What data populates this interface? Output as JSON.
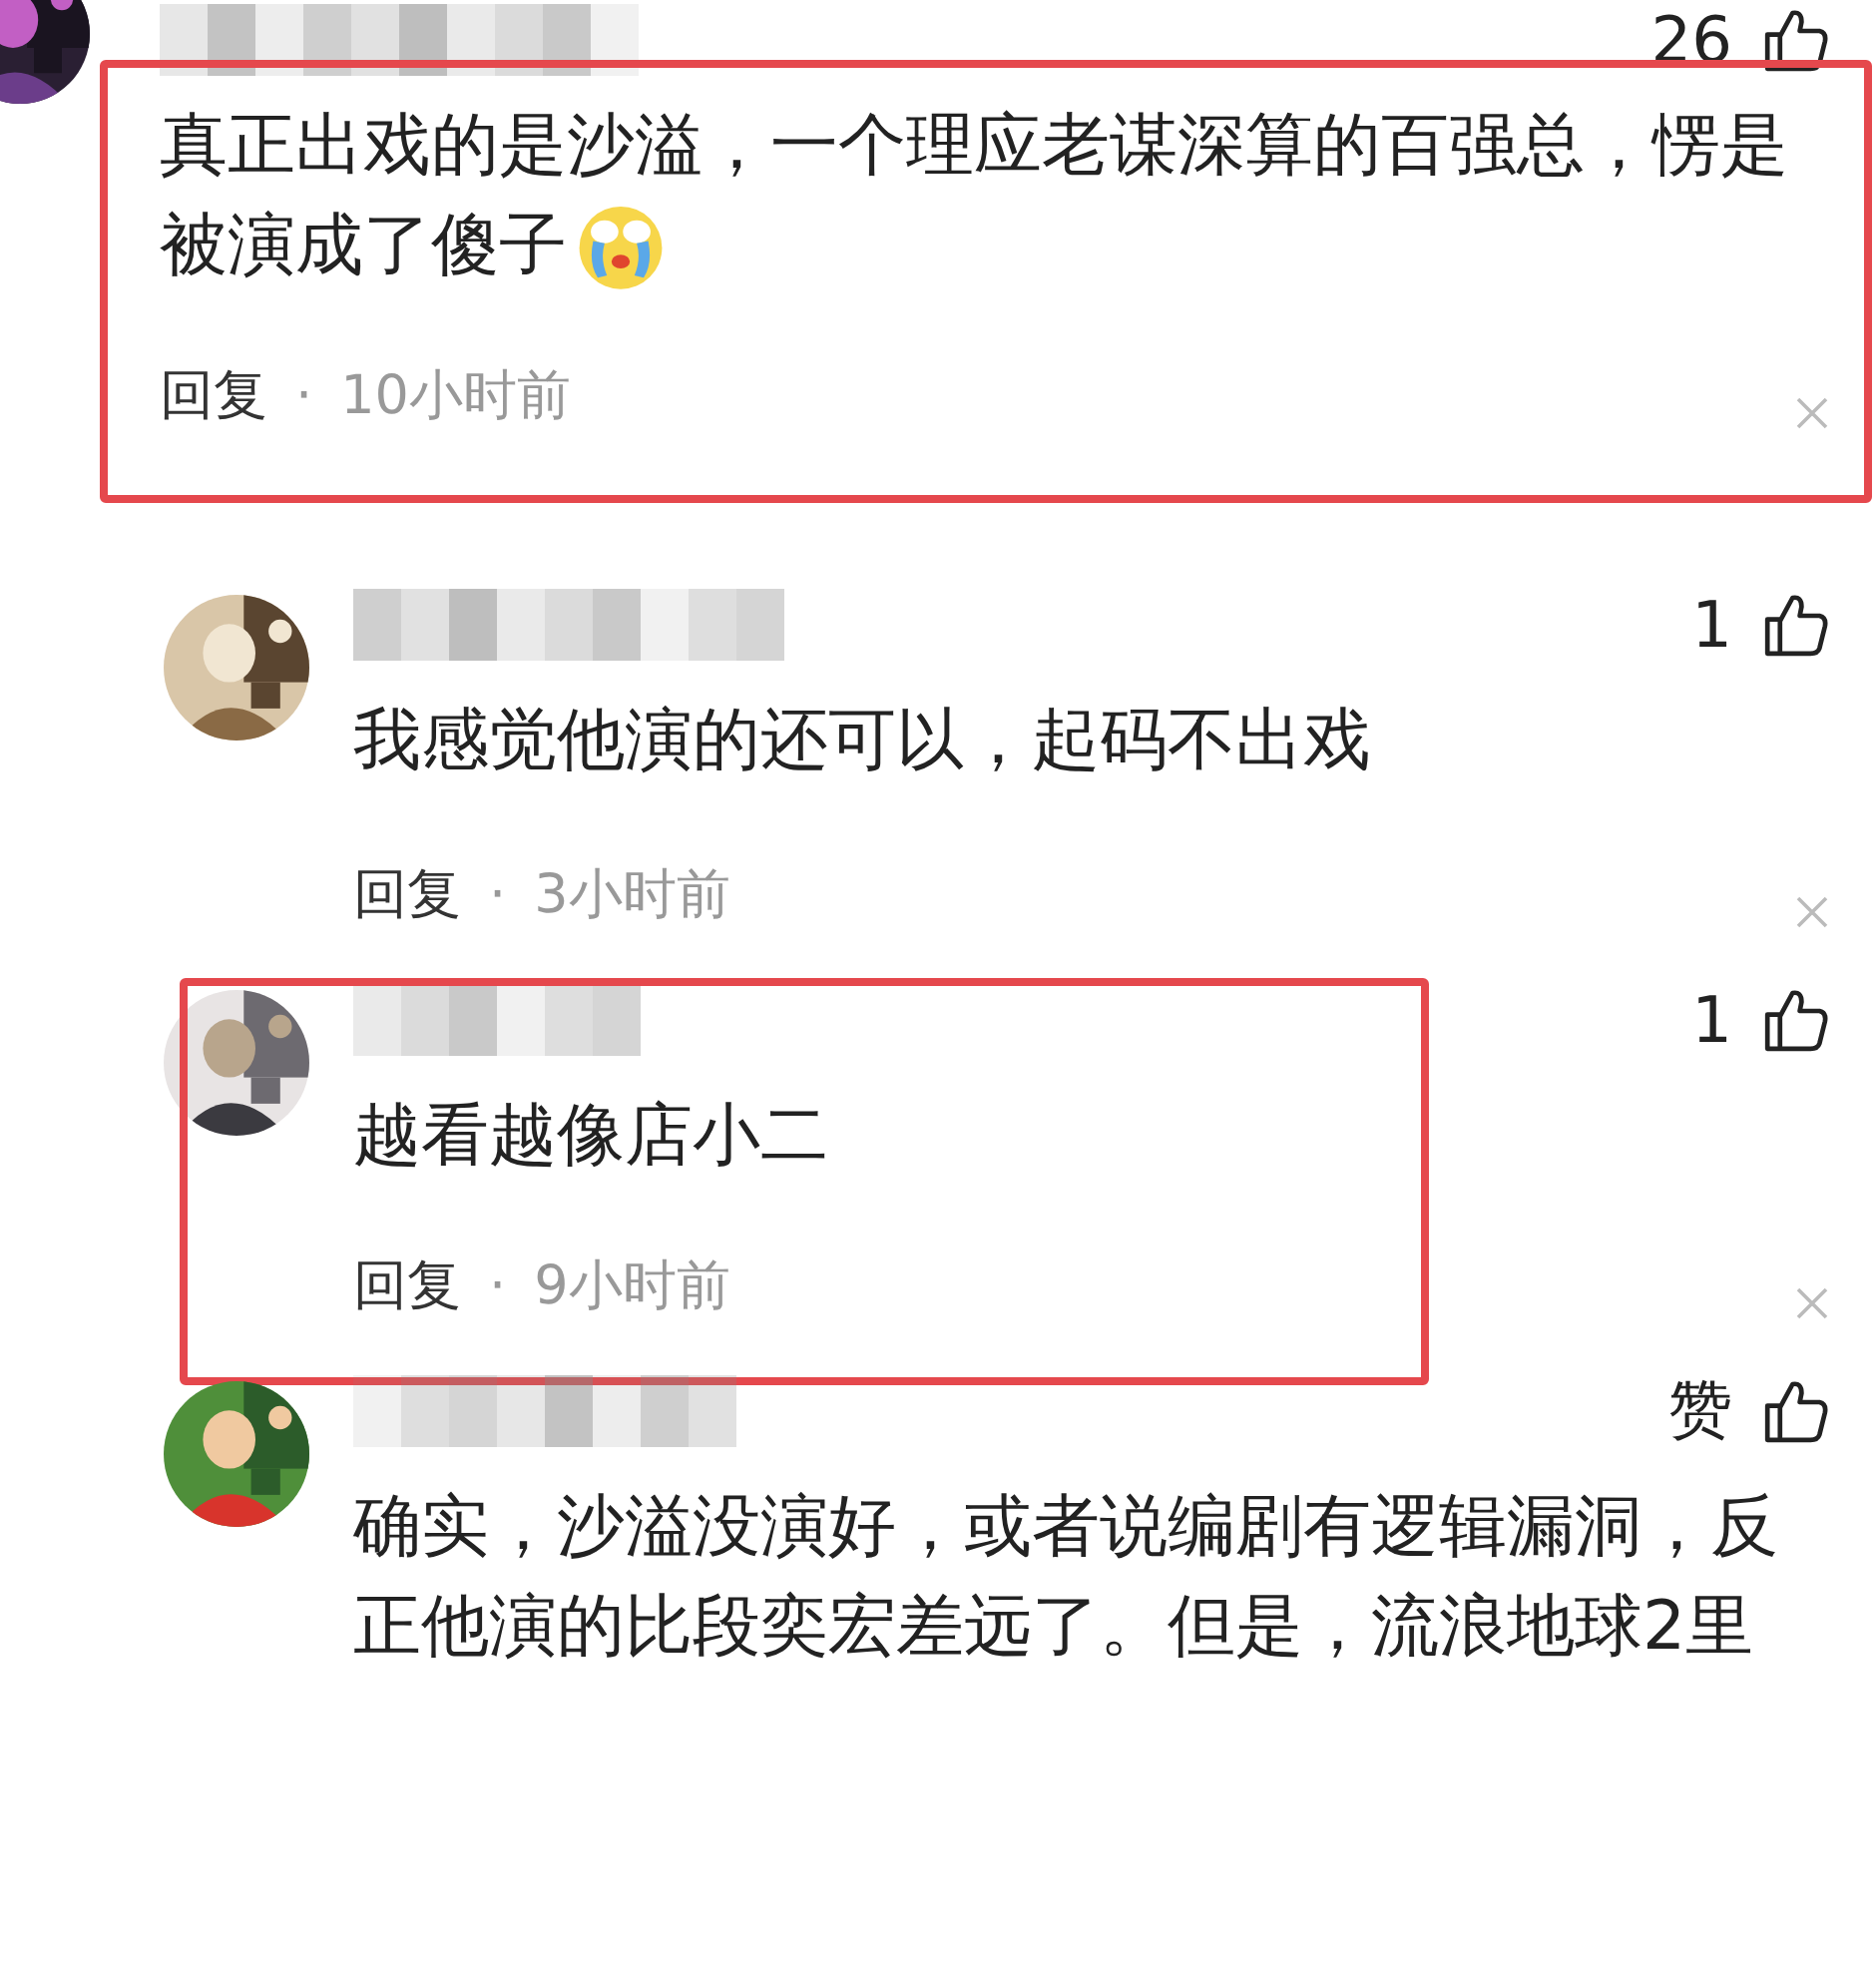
{
  "comments": [
    {
      "kind": "top",
      "highlighted": true,
      "likes": "26",
      "lines": [
        "真正出戏的是沙溢，一个理应老谋深算的百强总，愣是",
        "被演成了傻子"
      ],
      "has_emoji": true,
      "reply": "回复",
      "separator": "·",
      "time": "10小时前"
    },
    {
      "kind": "reply",
      "highlighted": false,
      "likes": "1",
      "lines": [
        "我感觉他演的还可以，起码不出戏"
      ],
      "has_emoji": false,
      "reply": "回复",
      "separator": "·",
      "time": "3小时前"
    },
    {
      "kind": "reply",
      "highlighted": true,
      "likes": "1",
      "lines": [
        "越看越像店小二"
      ],
      "has_emoji": false,
      "reply": "回复",
      "separator": "·",
      "time": "9小时前"
    },
    {
      "kind": "reply",
      "highlighted": false,
      "likes": "赞",
      "lines": [
        "确实，沙溢没演好，或者说编剧有逻辑漏洞，反",
        "正他演的比段奕宏差远了。但是，流浪地球2里"
      ],
      "has_emoji": false
    }
  ]
}
